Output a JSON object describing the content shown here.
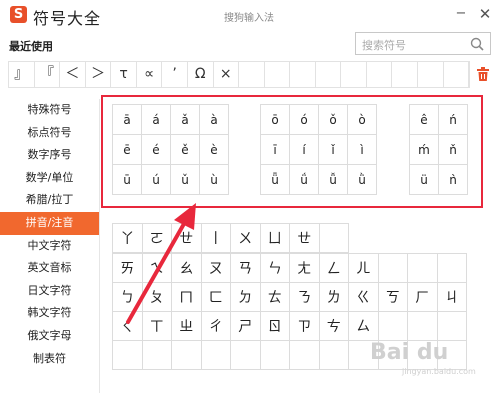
{
  "app": {
    "logo": "S",
    "title": "符号大全",
    "subtitle": "搜狗输入法",
    "min": "−",
    "close": "✕"
  },
  "recent": {
    "label": "最近使用",
    "items": [
      "』",
      "『",
      "＜",
      "＞",
      "τ",
      "∝",
      "’",
      "Ω",
      "×",
      "",
      "",
      "",
      "",
      "",
      "",
      "",
      "",
      ""
    ]
  },
  "search": {
    "placeholder": "搜索符号"
  },
  "sidebar": {
    "items": [
      "特殊符号",
      "标点符号",
      "数字序号",
      "数学/单位",
      "希腊/拉丁",
      "拼音/注音",
      "中文字符",
      "英文音标",
      "日文字符",
      "韩文字符",
      "俄文字母",
      "制表符"
    ],
    "active_index": 5,
    "active_color": "#f1682e"
  },
  "pinyin": {
    "group1": [
      "ā",
      "á",
      "ǎ",
      "à",
      "ē",
      "é",
      "ě",
      "è",
      "ū",
      "ú",
      "ǔ",
      "ù"
    ],
    "group2": [
      "ō",
      "ó",
      "ǒ",
      "ò",
      "ī",
      "í",
      "ǐ",
      "ì",
      "ǖ",
      "ǘ",
      "ǚ",
      "ǜ"
    ],
    "group3": [
      "ê",
      "ń",
      "ḿ",
      "ň",
      "ü",
      "ǹ"
    ]
  },
  "zhuyin": {
    "row1": [
      "丫",
      "ㄛ",
      "ㄝ",
      "丨",
      "ㄨ",
      "ㄩ",
      "ㄝ",
      ""
    ],
    "rows": [
      "ㄞ",
      "ㄟ",
      "ㄠ",
      "ㄡ",
      "ㄢ",
      "ㄣ",
      "ㄤ",
      "ㄥ",
      "ㄦ",
      "",
      "",
      "",
      "ㄅ",
      "ㄆ",
      "ㄇ",
      "ㄈ",
      "ㄉ",
      "ㄊ",
      "ㄋ",
      "ㄌ",
      "ㄍ",
      "ㄎ",
      "ㄏ",
      "ㄐ",
      "ㄑ",
      "ㄒ",
      "ㄓ",
      "ㄔ",
      "ㄕ",
      "ㄖ",
      "ㄗ",
      "ㄘ",
      "ㄙ",
      "",
      "",
      "",
      "",
      "",
      "",
      "",
      "",
      "",
      "",
      "",
      "",
      "",
      "",
      ""
    ]
  },
  "watermark": {
    "text": "Bai du",
    "sub": "jingyan.baidu.com"
  },
  "colors": {
    "highlight": "#e8283c",
    "arrow": "#e8283c",
    "accent": "#f1682e"
  }
}
